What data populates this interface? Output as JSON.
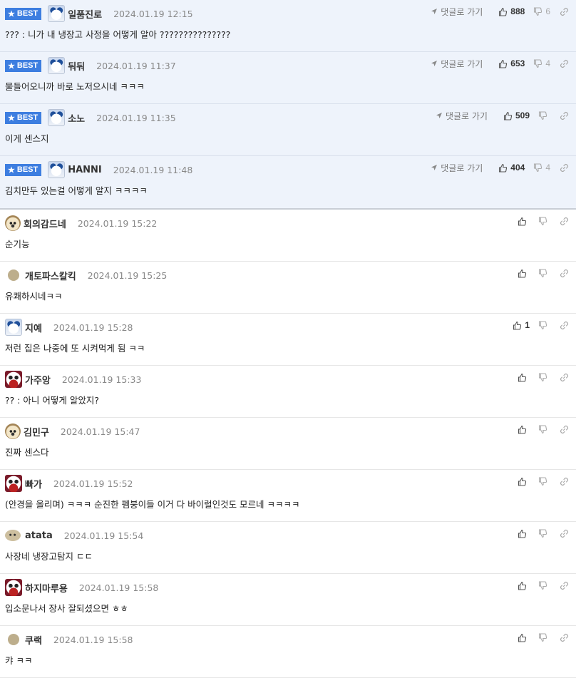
{
  "labels": {
    "best": "BEST",
    "reply_link": "댓글로 가기"
  },
  "comments": [
    {
      "best": true,
      "nick": "일품진로",
      "date": "2024.01.19 12:15",
      "text": "??? : 니가 내 냉장고 사정을 어떻게 알아 ???????????????",
      "up": "888",
      "down": "6",
      "avatar": "av-dog"
    },
    {
      "best": true,
      "nick": "둬둬",
      "date": "2024.01.19 11:37",
      "text": "물들어오니까 바로 노저으시네 ㅋㅋㅋ",
      "up": "653",
      "down": "4",
      "avatar": "av-dog"
    },
    {
      "best": true,
      "nick": "소노",
      "date": "2024.01.19 11:35",
      "text": "이게 센스지",
      "up": "509",
      "down": "",
      "avatar": "av-dog"
    },
    {
      "best": true,
      "nick": "HANNI",
      "date": "2024.01.19 11:48",
      "text": "김치만두 있는걸 어떻게 알지 ㅋㅋㅋㅋ",
      "up": "404",
      "down": "4",
      "avatar": "av-dog"
    },
    {
      "best": false,
      "nick": "회의감드네",
      "date": "2024.01.19 15:22",
      "text": "순기능",
      "up": "",
      "down": "",
      "avatar": "av-puppy"
    },
    {
      "best": false,
      "nick": "개토파스칼킥",
      "date": "2024.01.19 15:25",
      "text": "유쾌하시네ㅋㅋ",
      "up": "",
      "down": "",
      "avatar": "av-round"
    },
    {
      "best": false,
      "nick": "지예",
      "date": "2024.01.19 15:28",
      "text": "저런 집은 나중에 또 시켜먹게 됨 ㅋㅋ",
      "up": "1",
      "down": "",
      "avatar": "av-dog"
    },
    {
      "best": false,
      "nick": "가주앙",
      "date": "2024.01.19 15:33",
      "text": "?? : 아니 어떻게 알았지?",
      "up": "",
      "down": "",
      "avatar": "av-mask"
    },
    {
      "best": false,
      "nick": "김민구",
      "date": "2024.01.19 15:47",
      "text": "진짜 센스다",
      "up": "",
      "down": "",
      "avatar": "av-puppy"
    },
    {
      "best": false,
      "nick": "빠가",
      "date": "2024.01.19 15:52",
      "text": "(안경을 올리며) ㅋㅋㅋ 순진한 펨붕이들 이거 다 바이럴인것도 모르네 ㅋㅋㅋㅋ",
      "up": "",
      "down": "",
      "avatar": "av-mask"
    },
    {
      "best": false,
      "nick": "atata",
      "date": "2024.01.19 15:54",
      "text": "사장네 냉장고탐지 ㄷㄷ",
      "up": "",
      "down": "",
      "avatar": "av-oval"
    },
    {
      "best": false,
      "nick": "하지마루용",
      "date": "2024.01.19 15:58",
      "text": "입소문나서 장사 잘되셨으면 ㅎㅎ",
      "up": "",
      "down": "",
      "avatar": "av-mask"
    },
    {
      "best": false,
      "nick": "쿠랙",
      "date": "2024.01.19 15:58",
      "text": "캬 ㅋㅋ",
      "up": "",
      "down": "",
      "avatar": "av-round"
    }
  ]
}
